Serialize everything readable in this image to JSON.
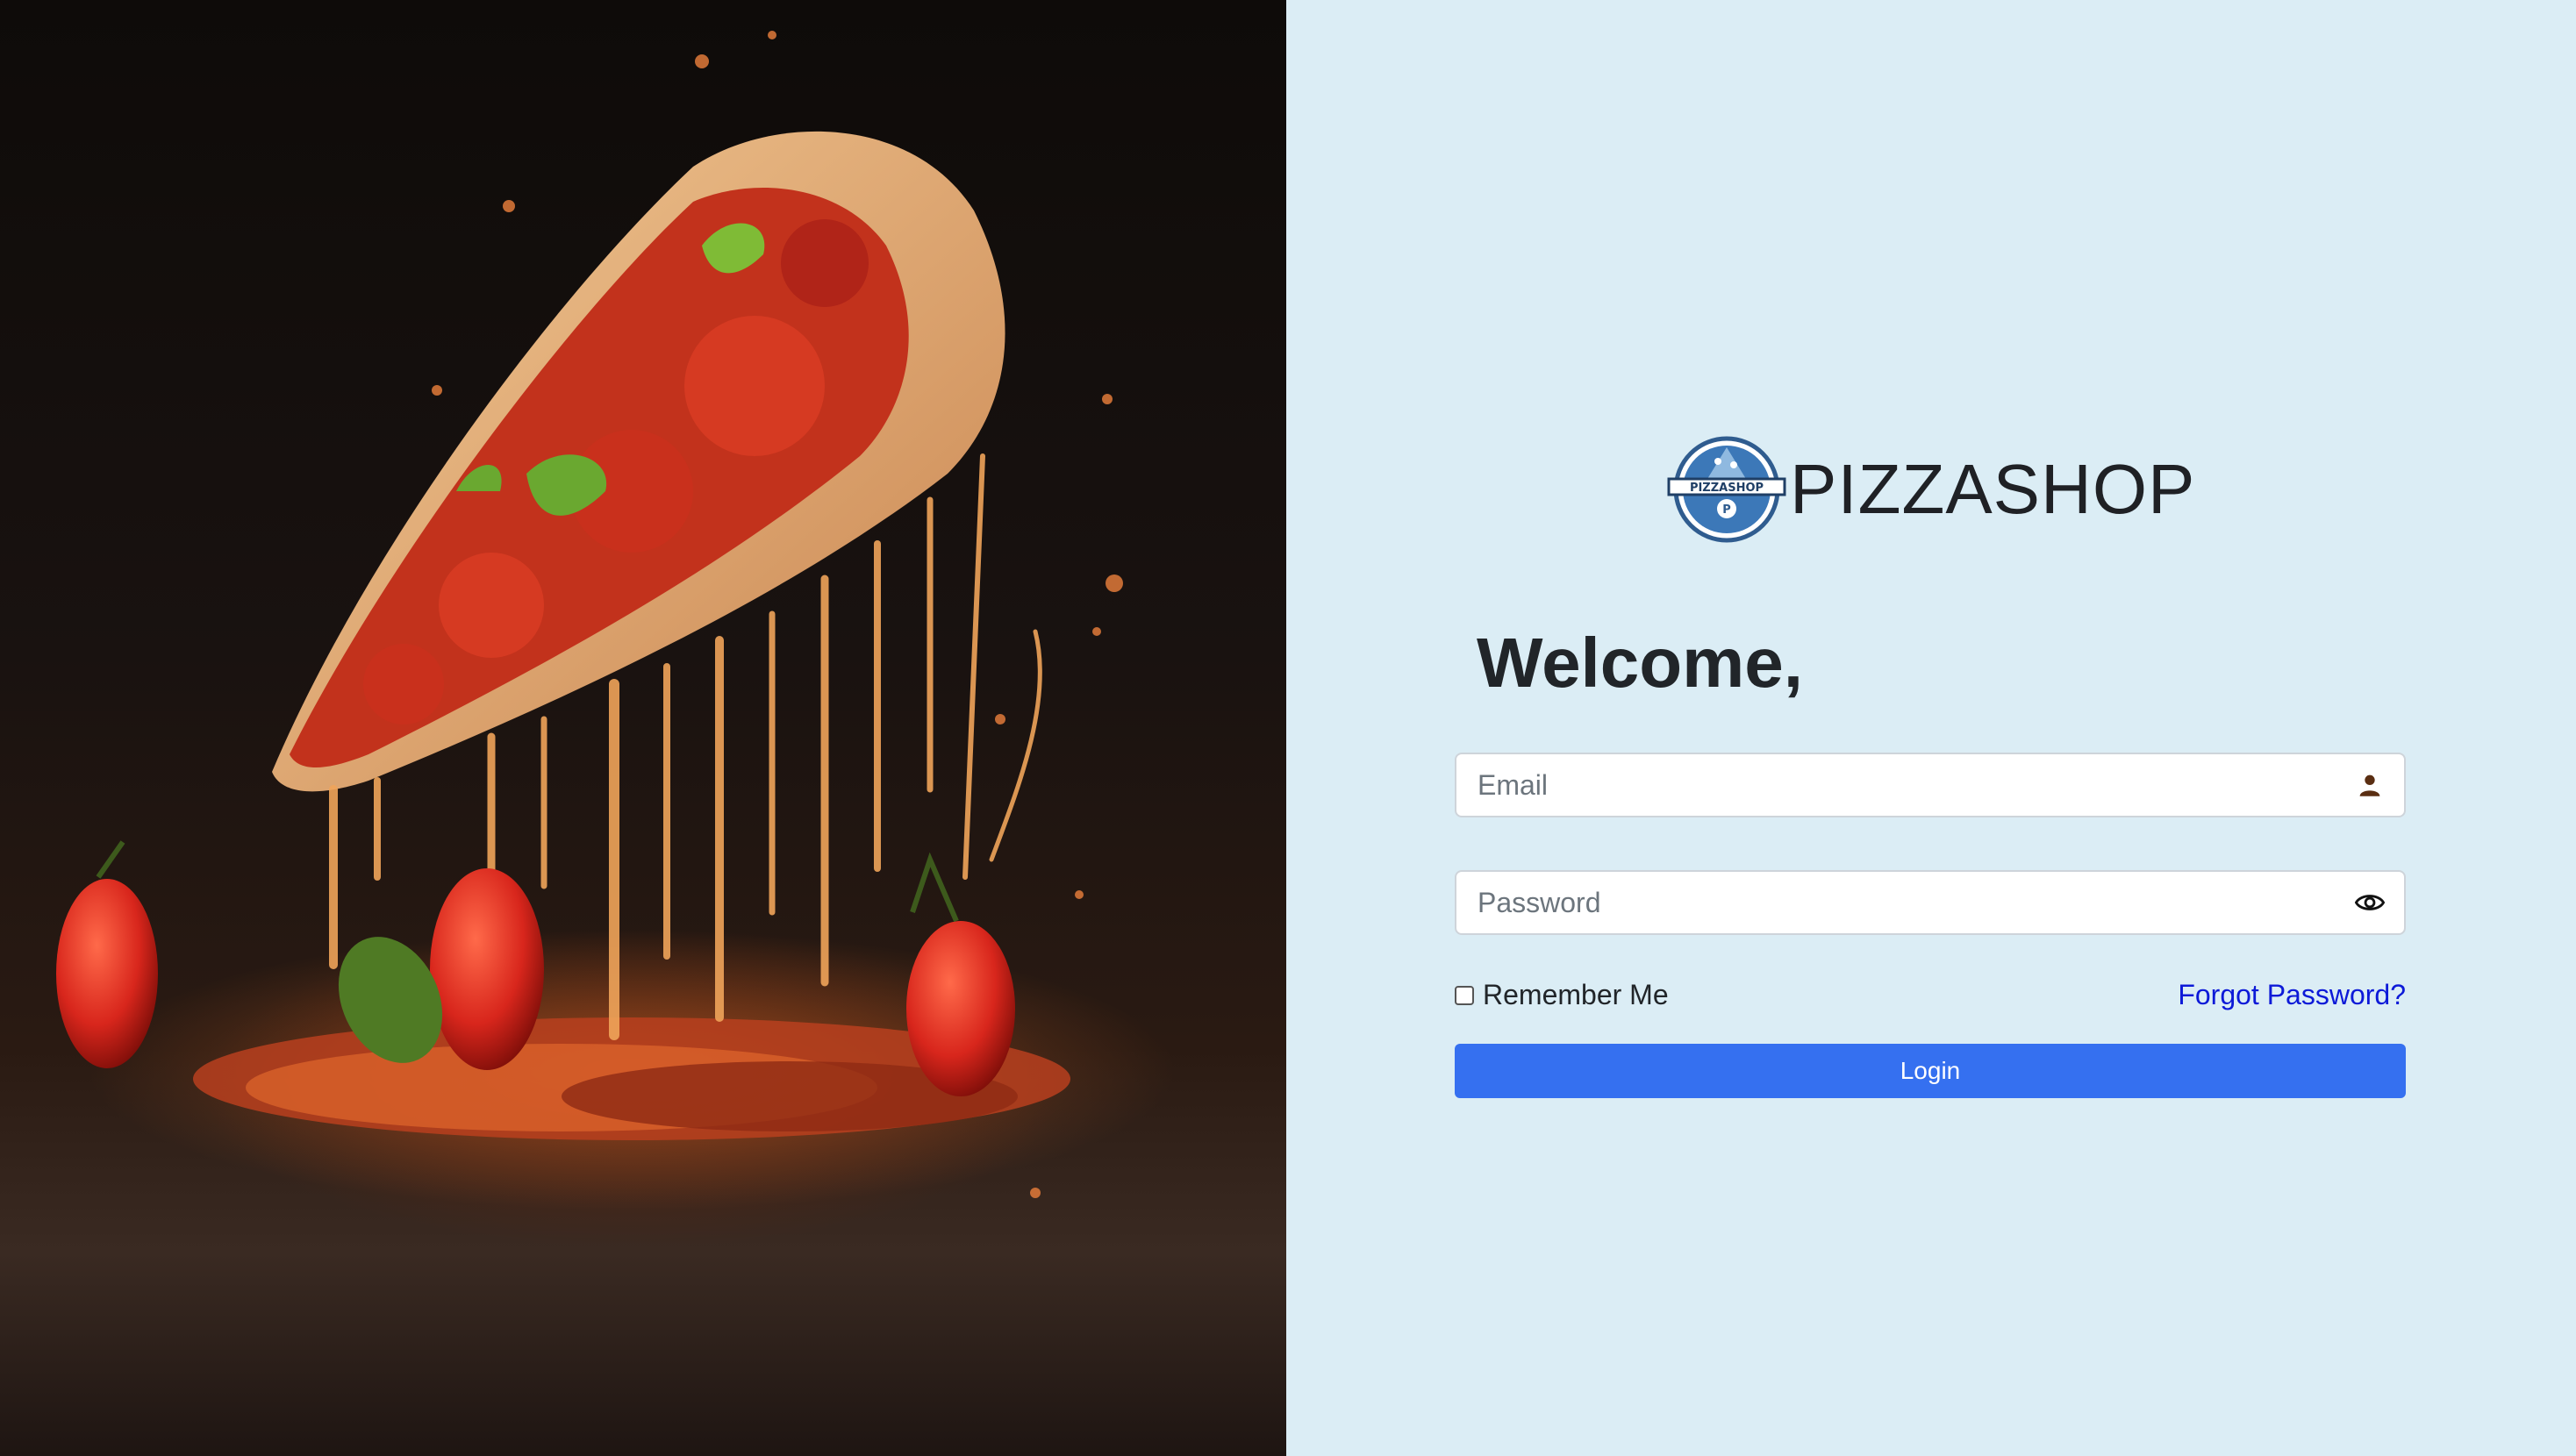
{
  "hero": {
    "image": "pizza-slice-with-melting-cheese-and-tomatoes"
  },
  "brand": {
    "name": "PIZZASHOP",
    "logo_text": "PIZZASHOP",
    "logo_letter": "P",
    "logo_icon": "pizza-shop-logo-icon"
  },
  "form": {
    "heading": "Welcome,",
    "email": {
      "placeholder": "Email",
      "value": "",
      "icon": "user-icon"
    },
    "password": {
      "placeholder": "Password",
      "value": "",
      "icon": "eye-icon"
    },
    "remember_label": "Remember Me",
    "remember_checked": false,
    "forgot_label": "Forgot Password?",
    "login_label": "Login"
  },
  "colors": {
    "panel_bg": "#dbedf5",
    "primary": "#3570f0",
    "link": "#0d1ad8",
    "text": "#212529"
  }
}
